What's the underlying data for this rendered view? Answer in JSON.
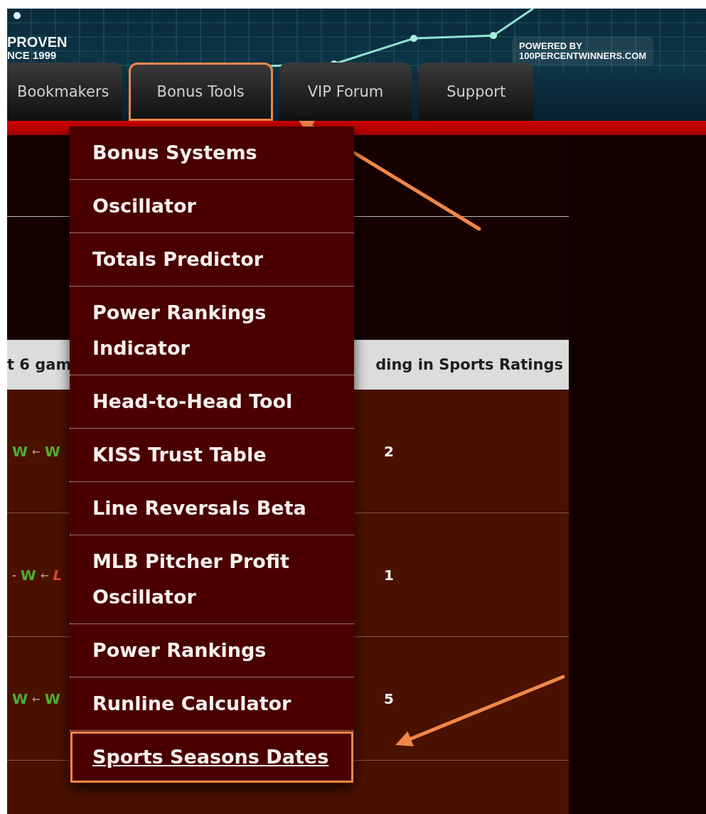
{
  "banner": {
    "tagline": [
      "PROVEN",
      "NCE 1999"
    ],
    "powered": [
      "POWERED BY",
      "100PERCENTWINNERS.COM"
    ]
  },
  "nav": {
    "tabs": [
      {
        "label": "Bookmakers",
        "highlighted": false
      },
      {
        "label": "Bonus Tools",
        "highlighted": true
      },
      {
        "label": "VIP Forum",
        "highlighted": false
      },
      {
        "label": "Support",
        "highlighted": false
      }
    ]
  },
  "dropdown": {
    "items": [
      {
        "label": "Bonus Systems",
        "hovered": false,
        "highlighted": false
      },
      {
        "label": "Oscillator",
        "hovered": false,
        "highlighted": false
      },
      {
        "label": "Totals Predictor",
        "hovered": false,
        "highlighted": false
      },
      {
        "label": "Power Rankings Indicator",
        "hovered": false,
        "highlighted": false
      },
      {
        "label": "Head-to-Head Tool",
        "hovered": false,
        "highlighted": false
      },
      {
        "label": "KISS Trust Table",
        "hovered": false,
        "highlighted": false
      },
      {
        "label": "Line Reversals Beta",
        "hovered": false,
        "highlighted": false
      },
      {
        "label": "MLB Pitcher Profit Oscillator",
        "hovered": false,
        "highlighted": false
      },
      {
        "label": "Power Rankings",
        "hovered": false,
        "highlighted": false
      },
      {
        "label": "Runline Calculator",
        "hovered": false,
        "highlighted": false
      },
      {
        "label": "Sports Seasons Dates",
        "hovered": true,
        "highlighted": true
      }
    ]
  },
  "table": {
    "columns": [
      "t 6 gam",
      "ding in Sports Ratings"
    ],
    "rows": [
      {
        "streak": [
          {
            "kind": "win",
            "text": "W"
          },
          {
            "kind": "arrow",
            "text": "←"
          },
          {
            "kind": "win",
            "text": "W"
          }
        ],
        "rank": "2"
      },
      {
        "streak": [
          {
            "kind": "arrow",
            "text": "-"
          },
          {
            "kind": "win",
            "text": "W"
          },
          {
            "kind": "arrow",
            "text": "←"
          },
          {
            "kind": "loss",
            "text": "L"
          }
        ],
        "rank": "1"
      },
      {
        "streak": [
          {
            "kind": "win",
            "text": "W"
          },
          {
            "kind": "arrow",
            "text": "←"
          },
          {
            "kind": "win",
            "text": "W"
          }
        ],
        "rank": "5"
      }
    ]
  }
}
